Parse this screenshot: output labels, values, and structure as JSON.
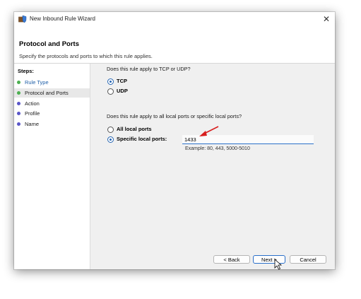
{
  "window": {
    "title": "New Inbound Rule Wizard",
    "icon": "firewall-shield-icon"
  },
  "header": {
    "title": "Protocol and Ports",
    "description": "Specify the protocols and ports to which this rule applies."
  },
  "steps": {
    "title": "Steps:",
    "items": [
      {
        "label": "Rule Type",
        "state": "done"
      },
      {
        "label": "Protocol and Ports",
        "state": "current"
      },
      {
        "label": "Action",
        "state": "pending"
      },
      {
        "label": "Profile",
        "state": "pending"
      },
      {
        "label": "Name",
        "state": "pending"
      }
    ]
  },
  "protocol": {
    "question": "Does this rule apply to TCP or UDP?",
    "options": [
      {
        "label": "TCP",
        "selected": true
      },
      {
        "label": "UDP",
        "selected": false
      }
    ]
  },
  "ports": {
    "question": "Does this rule apply to all local ports or specific local ports?",
    "options": [
      {
        "label": "All local ports",
        "selected": false
      },
      {
        "label": "Specific local ports:",
        "selected": true
      }
    ],
    "value": "1433",
    "example": "Example: 80, 443, 5000-5010"
  },
  "buttons": {
    "back": "< Back",
    "next": "Next >",
    "cancel": "Cancel"
  },
  "colors": {
    "accent": "#2666b3",
    "annotation_arrow": "#d81e1e",
    "step_done": "#4caf50",
    "step_pending": "#5a56c8"
  }
}
